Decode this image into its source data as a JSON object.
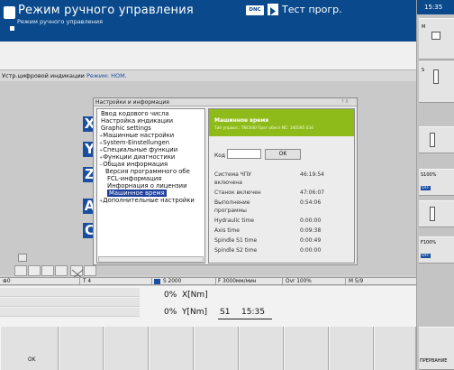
{
  "header": {
    "mode_title": "Режим ручного управления",
    "mode_subtitle": "Режим ручного управления",
    "dnc_label": "DNC",
    "program_title": "Тест прогр."
  },
  "status_line": {
    "text": "Устр.цифровой индикации ",
    "mode_label": "Режим: НОМ."
  },
  "dialog": {
    "title": "Настройки и информация",
    "controls": "? X",
    "tree": [
      {
        "label": "Ввод кодового числа",
        "prefix": ""
      },
      {
        "label": "Настройка индикации",
        "prefix": ""
      },
      {
        "label": "Graphic settings",
        "prefix": ""
      },
      {
        "label": "Машинные настройки",
        "prefix": "+"
      },
      {
        "label": "System-Einstellungen",
        "prefix": "+"
      },
      {
        "label": "Специальные функции",
        "prefix": "+"
      },
      {
        "label": "Функции диагностики",
        "prefix": "+"
      },
      {
        "label": "Общая информация",
        "prefix": "−"
      },
      {
        "label": "Версия программного обе",
        "prefix": ""
      },
      {
        "label": "FCL-информация",
        "prefix": ""
      },
      {
        "label": "Инфорнация о лицензии",
        "prefix": ""
      },
      {
        "label": "Машинное время",
        "prefix": ""
      },
      {
        "label": "Дополнительные настройки",
        "prefix": "+"
      }
    ],
    "panel": {
      "heading": "Машинное время",
      "subheading": "Тип управл.: TNC640 Прог обесп NC: 340595 034",
      "code_label": "Код",
      "ok_label": "OK",
      "rows": [
        {
          "label": "Система ЧПУ",
          "value": "46:19:54"
        },
        {
          "label": "включена",
          "value": ""
        },
        {
          "label": "Станок включен",
          "value": "47:06:07"
        },
        {
          "label": "Выполнение",
          "value": "0:54:06"
        },
        {
          "label": "программы",
          "value": ""
        },
        {
          "label": "Hydraulic time",
          "value": "0:00:00"
        },
        {
          "label": "Axis time",
          "value": "0:09:38"
        },
        {
          "label": "Spindle S1 time",
          "value": "0:00:49"
        },
        {
          "label": "Spindle S2 time",
          "value": "0:00:00"
        }
      ]
    }
  },
  "axes": [
    "X",
    "Y",
    "Z",
    "A",
    "C"
  ],
  "statusbar": {
    "t": "T 4",
    "s": "S 2000",
    "f": "F 3000мм/мин",
    "ovr": "Ovr 100%",
    "m": "M 5/9"
  },
  "position": {
    "line1_pct": "0%",
    "line1_axis": "X[Nm]",
    "line2_pct": "0%",
    "line2_axis": "Y[Nm]",
    "spindle": "S1",
    "time": "15:35"
  },
  "softkeys": {
    "ok": "OK",
    "abort": "ПРЕРВАНИЕ"
  },
  "side": {
    "time": "15:35",
    "m_label": "M",
    "s_label": "S",
    "s100": "S100%",
    "off1": "OFF",
    "f100": "F100%",
    "off2": "OFF"
  }
}
